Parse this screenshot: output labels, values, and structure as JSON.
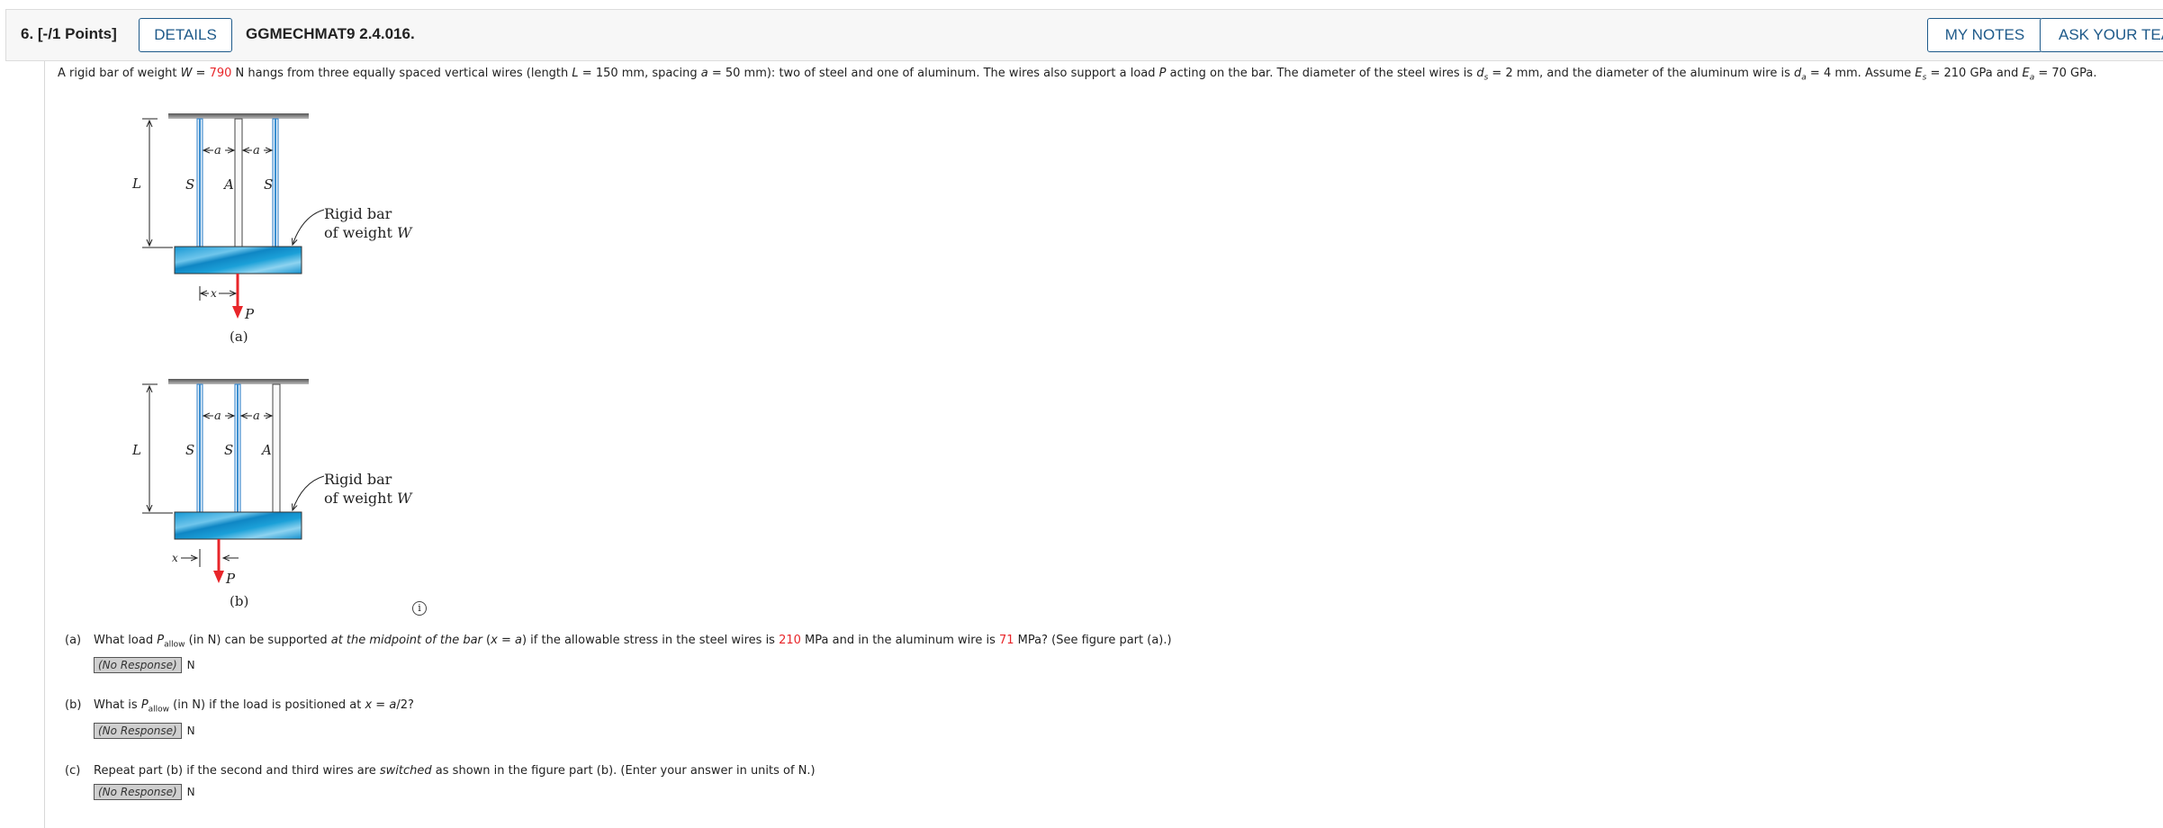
{
  "header": {
    "question_number": "6. [-/1 Points]",
    "details_label": "DETAILS",
    "question_code": "GGMECHMAT9 2.4.016.",
    "my_notes_label": "MY NOTES",
    "ask_teacher_label": "ASK YOUR TEACHER"
  },
  "prompt": {
    "t1": "A rigid bar of weight ",
    "W": "W",
    "eq": " = ",
    "W_value": "790",
    "t2": " N hangs from three equally spaced vertical wires (length ",
    "L": "L",
    "t3": " = 150 mm, spacing ",
    "a": "a",
    "t4": " = 50 mm): two of steel and one of aluminum. The wires also support a load ",
    "P": "P",
    "t5": " acting on the bar. The diameter of the steel wires is ",
    "d": "d",
    "s": "s",
    "t6": " = 2 mm, and the diameter of the aluminum wire is ",
    "d2": "d",
    "sub_a": "a",
    "t7": " = 4 mm. Assume ",
    "E": "E",
    "s2": "s",
    "t8": " = 210 GPa and ",
    "E2": "E",
    "sub_a2": "a",
    "t9": " = 70 GPa."
  },
  "figure_a": {
    "L": "L",
    "a1": "a",
    "a2": "a",
    "wire1": "S",
    "wire2": "A",
    "wire3": "S",
    "bar_label_1": "Rigid bar",
    "bar_label_2": "of weight ",
    "bar_label_W": "W",
    "x": "x",
    "P": "P",
    "caption": "(a)"
  },
  "figure_b": {
    "L": "L",
    "a1": "a",
    "a2": "a",
    "wire1": "S",
    "wire2": "S",
    "wire3": "A",
    "bar_label_1": "Rigid bar",
    "bar_label_2": "of weight ",
    "bar_label_W": "W",
    "x": "x",
    "P": "P",
    "caption": "(b)"
  },
  "info_icon": "i",
  "parts": {
    "a": {
      "label": "(a)",
      "t1": "What load ",
      "P": "P",
      "sub": "allow",
      "t2": " (in N) can be supported ",
      "it": "at the midpoint of the bar",
      "t3": " (",
      "x": "x",
      "t4": " = ",
      "a": "a",
      "t5": ") if the allowable stress in the steel wires is ",
      "steel_value": "210",
      "t6": " MPa and in the aluminum wire is ",
      "al_value": "71",
      "t7": " MPa? (See figure part (a).)",
      "response": "(No Response)",
      "unit": "N"
    },
    "b": {
      "label": "(b)",
      "t1": "What is ",
      "P": "P",
      "sub": "allow",
      "t2": " (in N) if the load is positioned at ",
      "x": "x",
      "t3": " = ",
      "a": "a",
      "t4": "/2?",
      "response": "(No Response)",
      "unit": "N"
    },
    "c": {
      "label": "(c)",
      "t1": "Repeat part (b) if the second and third wires are ",
      "it": "switched",
      "t2": " as shown in the figure part (b). (Enter your answer in units of N.)",
      "response": "(No Response)",
      "unit": "N"
    }
  },
  "colors": {
    "accent": "#1e5a8a",
    "highlight": "#e8262a",
    "bar_blue": "#1ba0d8",
    "wire_blue": "#3b8fd0"
  }
}
